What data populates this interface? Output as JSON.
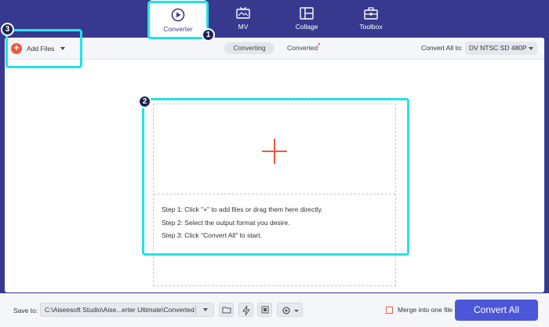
{
  "nav": {
    "items": [
      {
        "label": "Converter",
        "icon": "converter-icon"
      },
      {
        "label": "MV",
        "icon": "tv-icon"
      },
      {
        "label": "Collage",
        "icon": "collage-icon"
      },
      {
        "label": "Toolbox",
        "icon": "toolbox-icon"
      }
    ]
  },
  "badges": [
    "1",
    "2",
    "3"
  ],
  "toolbar": {
    "add_files": "Add Files",
    "tab_converting": "Converting",
    "tab_converted": "Converted",
    "convert_all_label": "Convert All to:",
    "format": "DV NTSC SD 480P"
  },
  "dropzone": {
    "plus": "+",
    "step1": "Step 1: Click \"+\" to add files or drag them here directly.",
    "step2": "Step 2: Select the output format you desire.",
    "step3": "Step 3: Click \"Convert All\" to start."
  },
  "bottom": {
    "save_label": "Save to:",
    "path": "C:\\Aiseesoft Studio\\Aise...erter Ultimate\\Converted",
    "merge_label": "Merge into one file",
    "convert_all_button": "Convert All"
  },
  "colors": {
    "accent": "#4b56d8",
    "highlight": "#25e1e8",
    "orange": "#ee5a3c",
    "background": "#37398f"
  }
}
